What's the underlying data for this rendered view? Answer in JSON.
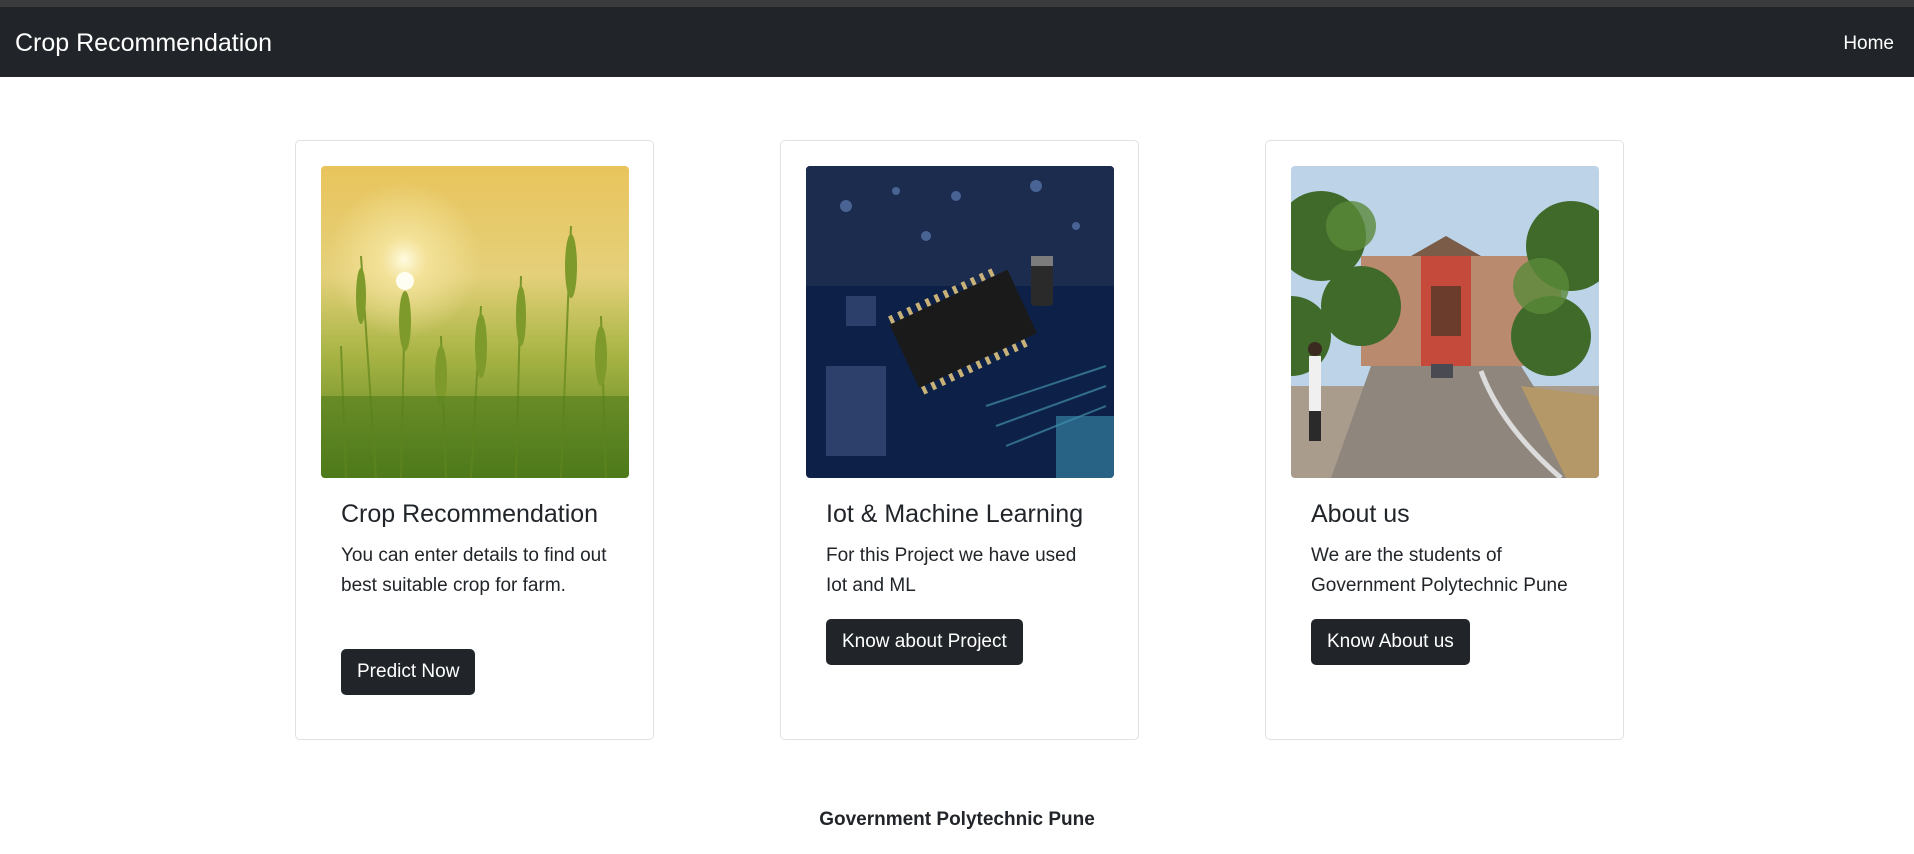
{
  "navbar": {
    "brand": "Crop Recommendation",
    "home": "Home"
  },
  "cards": [
    {
      "title": "Crop Recommendation",
      "text": "You can enter details to find out best suitable crop for farm.",
      "button": "Predict Now"
    },
    {
      "title": "Iot & Machine Learning",
      "text": "For this Project we have used Iot and ML",
      "button": "Know about Project"
    },
    {
      "title": "About us",
      "text": "We are the students of Government Polytechnic Pune",
      "button": "Know About us"
    }
  ],
  "footer": {
    "text": "Government Polytechnic Pune"
  },
  "colors": {
    "navbar": "#212529",
    "button": "#212529",
    "card_border": "#dfe1e4"
  }
}
